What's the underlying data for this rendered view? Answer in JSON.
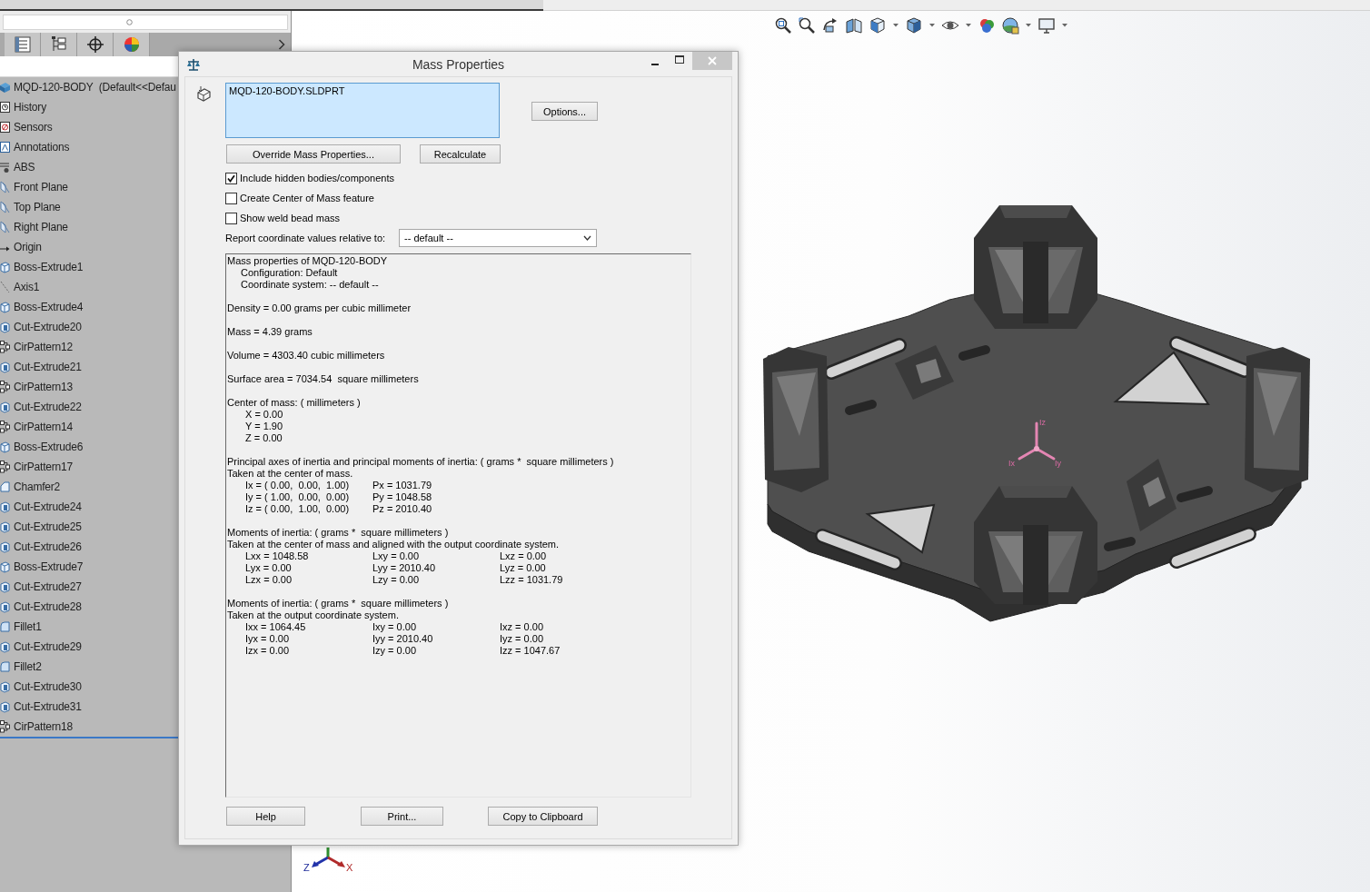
{
  "feature_tree": {
    "items": [
      {
        "label": "MQD-120-BODY  (Default<<Defau",
        "kind": "part"
      },
      {
        "label": "History",
        "kind": "history"
      },
      {
        "label": "Sensors",
        "kind": "sensors"
      },
      {
        "label": "Annotations",
        "kind": "annotations"
      },
      {
        "label": "ABS",
        "kind": "material"
      },
      {
        "label": "Front Plane",
        "kind": "plane"
      },
      {
        "label": "Top Plane",
        "kind": "plane"
      },
      {
        "label": "Right Plane",
        "kind": "plane"
      },
      {
        "label": "Origin",
        "kind": "origin"
      },
      {
        "label": "Boss-Extrude1",
        "kind": "boss"
      },
      {
        "label": "Axis1",
        "kind": "axis"
      },
      {
        "label": "Boss-Extrude4",
        "kind": "boss"
      },
      {
        "label": "Cut-Extrude20",
        "kind": "cut"
      },
      {
        "label": "CirPattern12",
        "kind": "pattern"
      },
      {
        "label": "Cut-Extrude21",
        "kind": "cut"
      },
      {
        "label": "CirPattern13",
        "kind": "pattern"
      },
      {
        "label": "Cut-Extrude22",
        "kind": "cut"
      },
      {
        "label": "CirPattern14",
        "kind": "pattern"
      },
      {
        "label": "Boss-Extrude6",
        "kind": "boss"
      },
      {
        "label": "CirPattern17",
        "kind": "pattern"
      },
      {
        "label": "Chamfer2",
        "kind": "chamfer"
      },
      {
        "label": "Cut-Extrude24",
        "kind": "cut"
      },
      {
        "label": "Cut-Extrude25",
        "kind": "cut"
      },
      {
        "label": "Cut-Extrude26",
        "kind": "cut"
      },
      {
        "label": "Boss-Extrude7",
        "kind": "boss"
      },
      {
        "label": "Cut-Extrude27",
        "kind": "cut"
      },
      {
        "label": "Cut-Extrude28",
        "kind": "cut"
      },
      {
        "label": "Fillet1",
        "kind": "fillet"
      },
      {
        "label": "Cut-Extrude29",
        "kind": "cut"
      },
      {
        "label": "Fillet2",
        "kind": "fillet"
      },
      {
        "label": "Cut-Extrude30",
        "kind": "cut"
      },
      {
        "label": "Cut-Extrude31",
        "kind": "cut"
      },
      {
        "label": "CirPattern18",
        "kind": "pattern"
      }
    ]
  },
  "viewport": {
    "principal_axes": {
      "labels": [
        "Iz",
        "Ix",
        "Iy"
      ]
    },
    "view_triad": {
      "labels": [
        "Z",
        "X"
      ]
    }
  },
  "dialog": {
    "title": "Mass Properties",
    "selection": {
      "items": [
        "MQD-120-BODY.SLDPRT"
      ]
    },
    "options_button": "Options...",
    "override_button": "Override Mass Properties...",
    "recalculate_button": "Recalculate",
    "checkboxes": [
      {
        "label": "Include hidden bodies/components",
        "checked": true
      },
      {
        "label": "Create Center of Mass feature",
        "checked": false
      },
      {
        "label": "Show weld bead mass",
        "checked": false
      }
    ],
    "coordinate_system": {
      "label": "Report coordinate values relative to:",
      "value": "-- default --"
    },
    "report": {
      "sections": [
        {
          "lines": [
            "Mass properties of MQD-120-BODY"
          ],
          "details": [
            "Configuration: Default",
            "Coordinate system: -- default --"
          ]
        },
        {
          "lines": [
            "Density = 0.00 grams per cubic millimeter"
          ]
        },
        {
          "lines": [
            "Mass = 4.39 grams"
          ]
        },
        {
          "lines": [
            "Volume = 4303.40 cubic millimeters"
          ]
        },
        {
          "lines": [
            "Surface area = 7034.54  square millimeters"
          ]
        },
        {
          "lines": [
            "Center of mass: ( millimeters )"
          ],
          "rows": [
            [
              "X = 0.00"
            ],
            [
              "Y = 1.90"
            ],
            [
              "Z = 0.00"
            ]
          ]
        },
        {
          "lines": [
            "Principal axes of inertia and principal moments of inertia: ( grams *  square millimeters )",
            "Taken at the center of mass."
          ],
          "rows": [
            [
              "Ix = ( 0.00,  0.00,  1.00)",
              "Px = 1031.79"
            ],
            [
              "Iy = ( 1.00,  0.00,  0.00)",
              "Py = 1048.58"
            ],
            [
              "Iz = ( 0.00,  1.00,  0.00)",
              "Pz = 2010.40"
            ]
          ]
        },
        {
          "lines": [
            "Moments of inertia: ( grams *  square millimeters )",
            "Taken at the center of mass and aligned with the output coordinate system."
          ],
          "rows": [
            [
              "Lxx = 1048.58",
              "Lxy = 0.00",
              "Lxz = 0.00"
            ],
            [
              "Lyx = 0.00",
              "Lyy = 2010.40",
              "Lyz = 0.00"
            ],
            [
              "Lzx = 0.00",
              "Lzy = 0.00",
              "Lzz = 1031.79"
            ]
          ]
        },
        {
          "lines": [
            "Moments of inertia: ( grams *  square millimeters )",
            "Taken at the output coordinate system."
          ],
          "rows": [
            [
              "Ixx = 1064.45",
              "Ixy = 0.00",
              "Ixz = 0.00"
            ],
            [
              "Iyx = 0.00",
              "Iyy = 2010.40",
              "Iyz = 0.00"
            ],
            [
              "Izx = 0.00",
              "Izy = 0.00",
              "Izz = 1047.67"
            ]
          ]
        }
      ]
    },
    "footer_buttons": [
      "Help",
      "Print...",
      "Copy to Clipboard"
    ]
  }
}
